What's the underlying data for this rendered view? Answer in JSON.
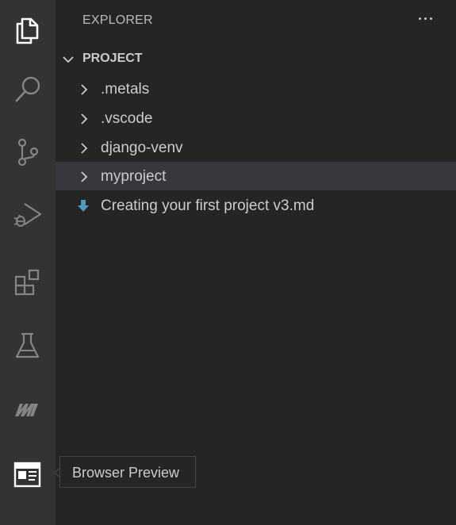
{
  "activity_bar": {
    "items": [
      {
        "name": "explorer",
        "icon": "files-icon",
        "active": true
      },
      {
        "name": "search",
        "icon": "search-icon",
        "active": false
      },
      {
        "name": "source-control",
        "icon": "source-control-icon",
        "active": false
      },
      {
        "name": "run-and-debug",
        "icon": "run-debug-icon",
        "active": false
      },
      {
        "name": "extensions",
        "icon": "extensions-icon",
        "active": false
      },
      {
        "name": "testing",
        "icon": "beaker-icon",
        "active": false
      },
      {
        "name": "metals",
        "icon": "metals-icon",
        "active": false
      },
      {
        "name": "browser-preview",
        "icon": "browser-preview-icon",
        "active": false
      }
    ]
  },
  "sidebar": {
    "title": "EXPLORER",
    "section": {
      "label": "PROJECT",
      "items": [
        {
          "label": ".metals",
          "type": "folder",
          "selected": false
        },
        {
          "label": ".vscode",
          "type": "folder",
          "selected": false
        },
        {
          "label": "django-venv",
          "type": "folder",
          "selected": false
        },
        {
          "label": "myproject",
          "type": "folder",
          "selected": true
        },
        {
          "label": "Creating your first project v3.md",
          "type": "markdown-file",
          "selected": false
        }
      ]
    }
  },
  "tooltip": {
    "text": "Browser Preview"
  },
  "colors": {
    "activity_bar_bg": "#333333",
    "sidebar_bg": "#252526",
    "selected_row_bg": "#37373d",
    "icon_inactive": "#858585",
    "icon_active": "#ffffff",
    "markdown_icon": "#519aba"
  }
}
